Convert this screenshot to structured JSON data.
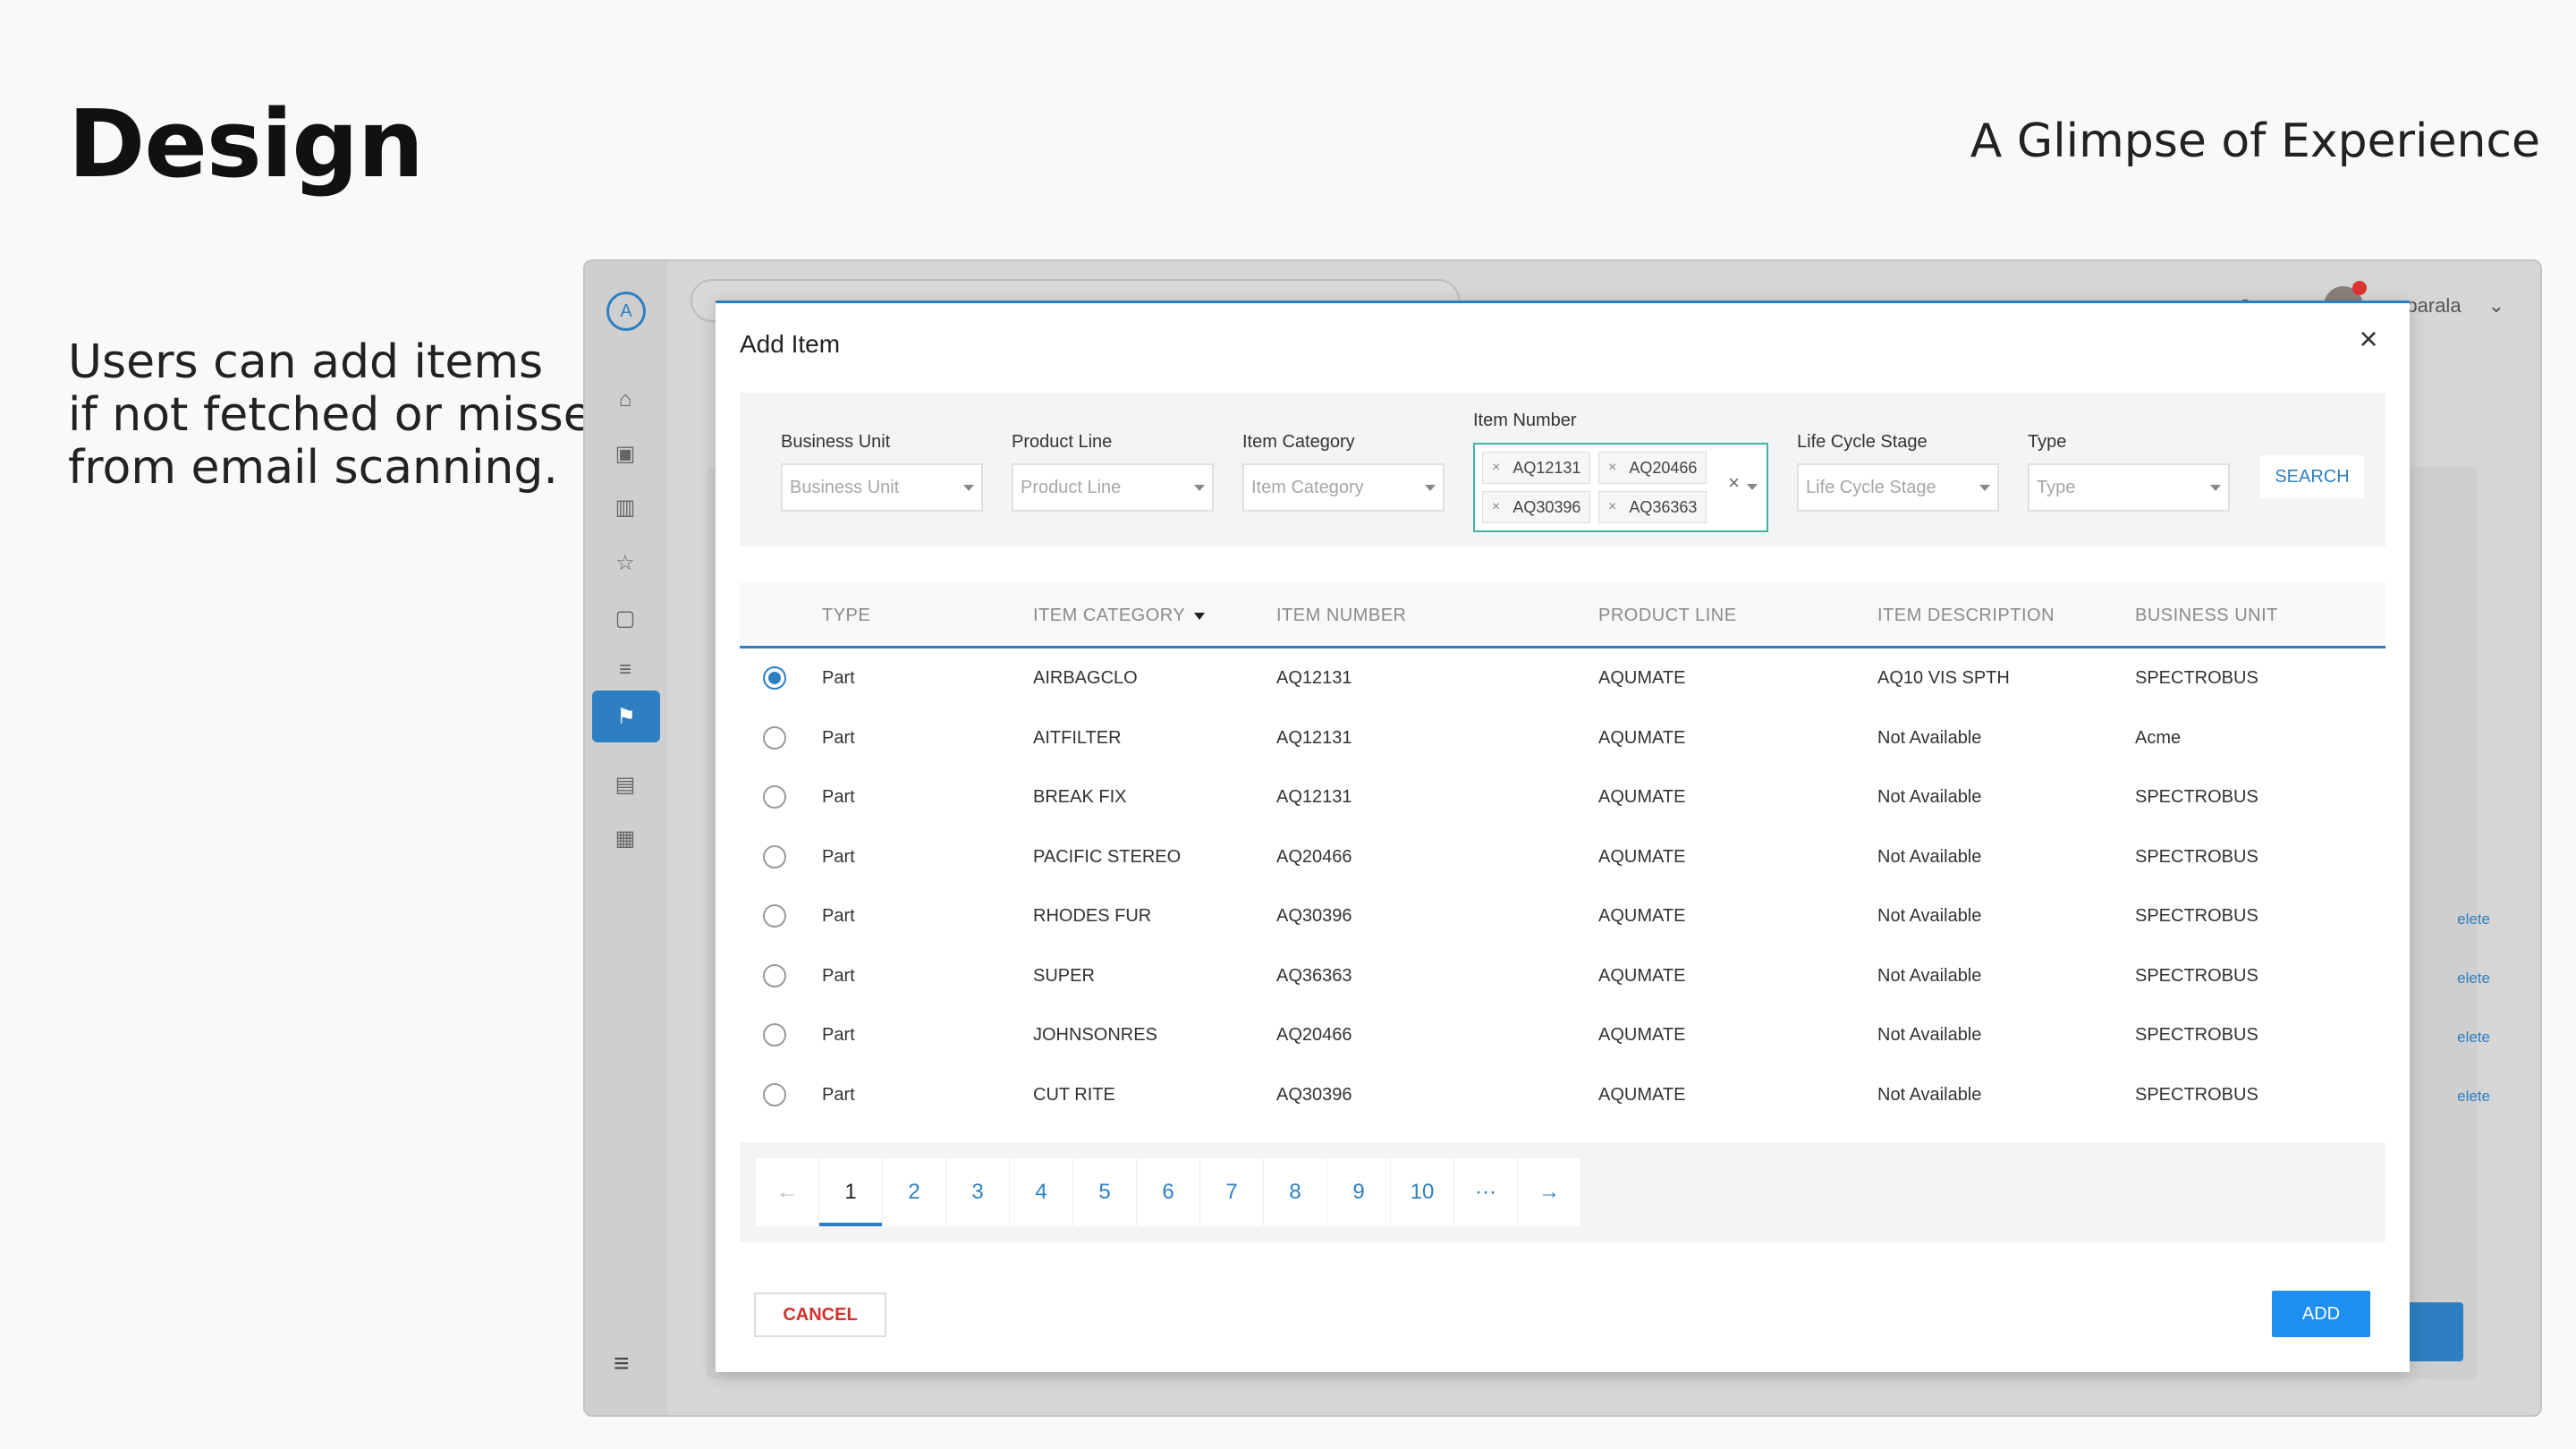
{
  "slide": {
    "title": "Design",
    "subtitle": "A Glimpse of Experience",
    "description_lines": [
      "Users can add items",
      "if not fetched or missed",
      "from email scanning."
    ]
  },
  "app": {
    "logo_letter": "A",
    "user_name_fragment": "mparala",
    "notification_count": "0",
    "bg_links": [
      "elete",
      "elete",
      "elete",
      "elete"
    ],
    "sidebar_icons": [
      "home-icon",
      "briefcase-icon",
      "building-icon",
      "star-icon",
      "contact-icon",
      "list-icon",
      "flag-icon",
      "clipboard-icon",
      "chart-icon",
      "menu-icon"
    ]
  },
  "modal": {
    "title": "Add Item",
    "close_symbol": "×",
    "filters": {
      "business_unit": {
        "label": "Business Unit",
        "placeholder": "Business Unit"
      },
      "product_line": {
        "label": "Product Line",
        "placeholder": "Product Line"
      },
      "item_category": {
        "label": "Item Category",
        "placeholder": "Item Category"
      },
      "item_number": {
        "label": "Item Number",
        "chips": [
          "AQ12131",
          "AQ20466",
          "AQ30396",
          "AQ36363"
        ],
        "clear_symbol": "×"
      },
      "life_cycle_stage": {
        "label": "Life Cycle Stage",
        "placeholder": "Life Cycle Stage"
      },
      "type": {
        "label": "Type",
        "placeholder": "Type"
      },
      "search_label": "SEARCH"
    },
    "table": {
      "columns": [
        "TYPE",
        "ITEM CATEGORY",
        "ITEM NUMBER",
        "PRODUCT LINE",
        "ITEM DESCRIPTION",
        "BUSINESS UNIT"
      ],
      "rows": [
        {
          "selected": true,
          "type": "Part",
          "category": "AIRBAGCLO",
          "number": "AQ12131",
          "product_line": "AQUMATE",
          "description": "AQ10 VIS SPTH",
          "business_unit": "SPECTROBUS"
        },
        {
          "selected": false,
          "type": "Part",
          "category": "AITFILTER",
          "number": "AQ12131",
          "product_line": "AQUMATE",
          "description": "Not Available",
          "business_unit": "Acme"
        },
        {
          "selected": false,
          "type": "Part",
          "category": "BREAK FIX",
          "number": "AQ12131",
          "product_line": "AQUMATE",
          "description": "Not Available",
          "business_unit": "SPECTROBUS"
        },
        {
          "selected": false,
          "type": "Part",
          "category": "PACIFIC STEREO",
          "number": "AQ20466",
          "product_line": "AQUMATE",
          "description": "Not Available",
          "business_unit": "SPECTROBUS"
        },
        {
          "selected": false,
          "type": "Part",
          "category": "RHODES FUR",
          "number": "AQ30396",
          "product_line": "AQUMATE",
          "description": "Not Available",
          "business_unit": "SPECTROBUS"
        },
        {
          "selected": false,
          "type": "Part",
          "category": "SUPER",
          "number": "AQ36363",
          "product_line": "AQUMATE",
          "description": "Not Available",
          "business_unit": "SPECTROBUS"
        },
        {
          "selected": false,
          "type": "Part",
          "category": "JOHNSONRES",
          "number": "AQ20466",
          "product_line": "AQUMATE",
          "description": "Not Available",
          "business_unit": "SPECTROBUS"
        },
        {
          "selected": false,
          "type": "Part",
          "category": "CUT RITE",
          "number": "AQ30396",
          "product_line": "AQUMATE",
          "description": "Not Available",
          "business_unit": "SPECTROBUS"
        }
      ]
    },
    "pagination": {
      "prev_symbol": "←",
      "pages": [
        "1",
        "2",
        "3",
        "4",
        "5",
        "6",
        "7",
        "8",
        "9",
        "10"
      ],
      "ellipsis": "···",
      "next_symbol": "→",
      "current": "1"
    },
    "cancel_label": "CANCEL",
    "add_label": "ADD"
  }
}
